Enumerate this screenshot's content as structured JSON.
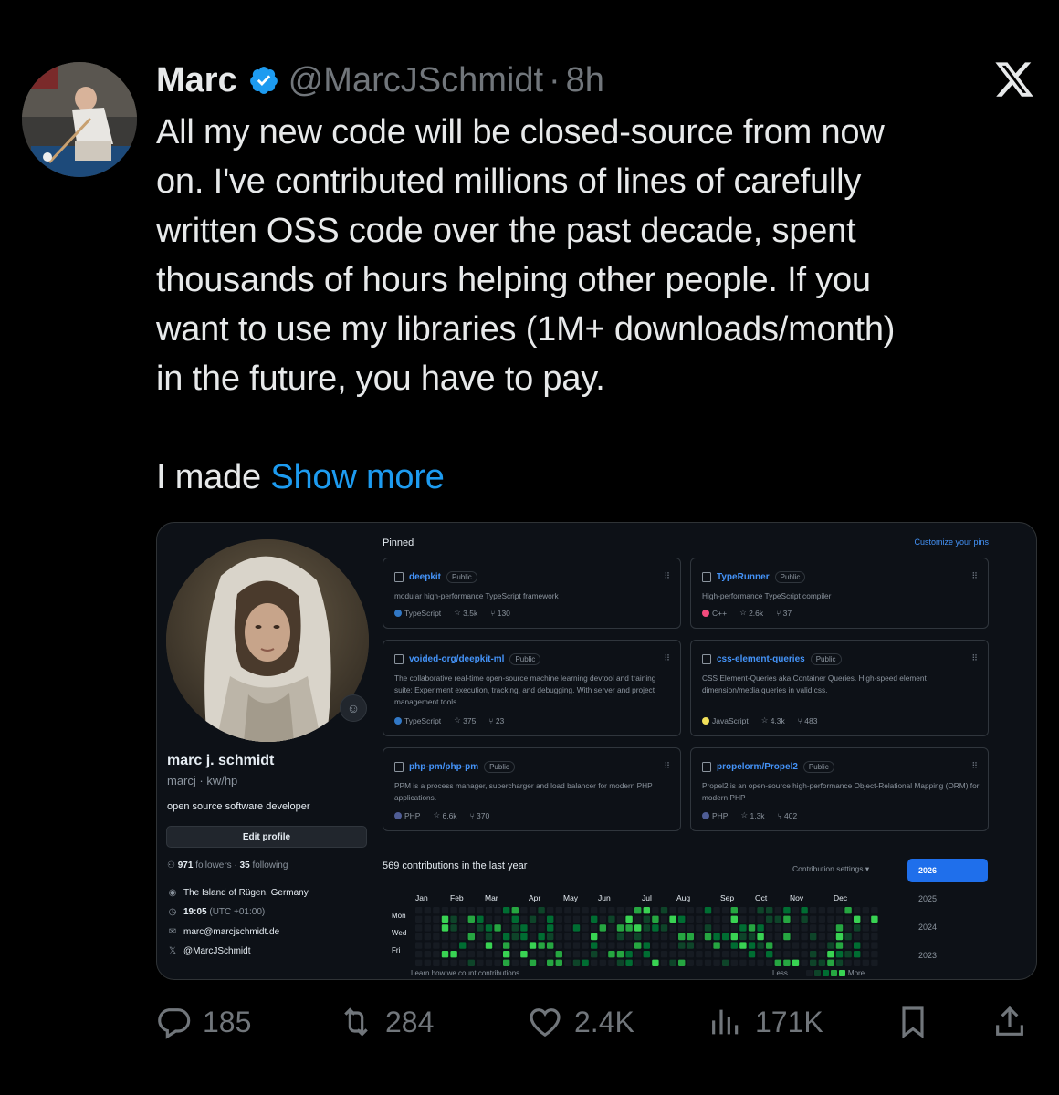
{
  "tweet": {
    "author_name": "Marc",
    "handle": "@MarcJSchmidt",
    "separator": "·",
    "time": "8h",
    "lines": [
      "All my new code will be closed-source from now",
      "on. I've contributed millions of lines of carefully",
      "written OSS code over the past decade, spent",
      "thousands of hours helping other people. If you",
      "want to use my libraries (1M+ downloads/month)",
      "in the future, you have to pay."
    ],
    "last_line_prefix": "I made ",
    "show_more": "Show more"
  },
  "github": {
    "profile": {
      "name": "marc j. schmidt",
      "login": "marcj · kw/hp",
      "bio": "open source software developer",
      "edit_button": "Edit profile",
      "followers_count": "971",
      "followers_label": " followers · ",
      "following_count": "35",
      "following_label": " following",
      "location": "The Island of Rügen, Germany",
      "time": "19:05",
      "timezone": "(UTC +01:00)",
      "email": "marc@marcjschmidt.de",
      "twitter": "@MarcJSchmidt"
    },
    "pinned_label": "Pinned",
    "customize_label": "Customize your pins",
    "repos": [
      {
        "name": "deepkit",
        "visibility": "Public",
        "desc": "modular high-performance TypeScript framework",
        "language": "TypeScript",
        "lang_color": "#3178c6",
        "stars": "3.5k",
        "forks": "130"
      },
      {
        "name": "TypeRunner",
        "visibility": "Public",
        "desc": "High-performance TypeScript compiler",
        "language": "C++",
        "lang_color": "#f34b7d",
        "stars": "2.6k",
        "forks": "37"
      },
      {
        "name": "voided-org/deepkit-ml",
        "visibility": "Public",
        "desc": "The collaborative real-time open-source machine learning devtool and training suite: Experiment execution, tracking, and debugging. With server and project management tools.",
        "language": "TypeScript",
        "lang_color": "#3178c6",
        "stars": "375",
        "forks": "23"
      },
      {
        "name": "css-element-queries",
        "visibility": "Public",
        "desc": "CSS Element-Queries aka Container Queries. High-speed element dimension/media queries in valid css.",
        "language": "JavaScript",
        "lang_color": "#f1e05a",
        "stars": "4.3k",
        "forks": "483"
      },
      {
        "name": "php-pm/php-pm",
        "visibility": "Public",
        "desc": "PPM is a process manager, supercharger and load balancer for modern PHP applications.",
        "language": "PHP",
        "lang_color": "#4f5d95",
        "stars": "6.6k",
        "forks": "370"
      },
      {
        "name": "propelorm/Propel2",
        "visibility": "Public",
        "desc": "Propel2 is an open-source high-performance Object-Relational Mapping (ORM) for modern PHP",
        "language": "PHP",
        "lang_color": "#4f5d95",
        "stars": "1.3k",
        "forks": "402"
      }
    ],
    "contributions": {
      "title": "569 contributions in the last year",
      "settings_label": "Contribution settings ▾",
      "months": [
        "Jan",
        "Feb",
        "Mar",
        "Apr",
        "May",
        "Jun",
        "Jul",
        "Aug",
        "Sep",
        "Oct",
        "Nov",
        "Dec"
      ],
      "days": [
        "Mon",
        "Wed",
        "Fri"
      ],
      "learn": "Learn how we count contributions",
      "less": "Less",
      "more": "More",
      "years": [
        "2026",
        "2025",
        "2024",
        "2023"
      ]
    }
  },
  "actions": {
    "replies": "185",
    "reposts": "284",
    "likes": "2.4K",
    "views": "171K"
  },
  "colors": {
    "accent": "#1d9bf0",
    "muted": "#71767b",
    "github_link": "#4493f8",
    "contrib_levels": [
      "#161b22",
      "#0e4429",
      "#006d32",
      "#26a641",
      "#39d353"
    ]
  }
}
